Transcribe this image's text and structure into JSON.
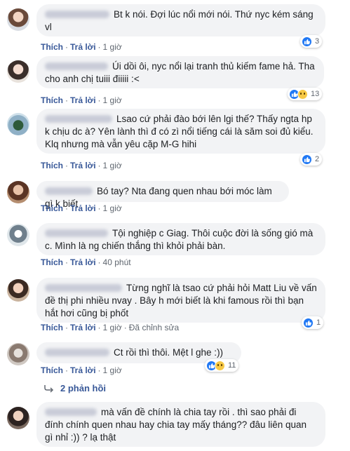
{
  "actions": {
    "like": "Thích",
    "reply": "Trả lời",
    "separator": "·"
  },
  "comments": [
    {
      "text": "Bt k nói. Đợi lúc nổi mới nói. Thứ nyc kém sáng vl",
      "time": "1 giờ",
      "edited": "",
      "reaction_count": "3"
    },
    {
      "text": "Úi dồi ôi, nyc nổi lại tranh thủ kiếm fame hả. Tha cho anh chị tuiii điiiii :<",
      "time": "1 giờ",
      "edited": "",
      "reaction_count": "13"
    },
    {
      "text": "Lsao cứ phải đào bới lên lgi thế? Thấy ngta hp k chịu dc à? Yên lành thì đ có zì nổi tiếng cái là săm soi đủ kiểu. Klq nhưng mà vẫn yêu cặp M-G hihi",
      "time": "1 giờ",
      "edited": "",
      "reaction_count": "2"
    },
    {
      "text": "Bó tay? Nta đang quen nhau bới móc làm gì k biết",
      "time": "1 giờ",
      "edited": "",
      "reaction_count": ""
    },
    {
      "text": "Tội nghiệp c Giag. Thôi cuộc đời là sống gió mà c. Mình là ng chiến thắng thì khỏi phải bàn.",
      "time": "40 phút",
      "edited": "",
      "reaction_count": ""
    },
    {
      "text": "Từng nghĩ là tsao cứ phải hỏi Matt Liu về vấn đề thị phi nhiều nvay . Bây h mới biết là khi famous rồi thì bạn hắt hơi cũng bị phốt",
      "time": "1 giờ",
      "edited": "Đã chỉnh sửa",
      "reaction_count": "1"
    },
    {
      "text": "Ct rồi thì thôi. Mệt l ghe :))",
      "time": "1 giờ",
      "edited": "",
      "reaction_count": "11"
    },
    {
      "text": "mà vấn đề chính là chia tay rồi . thì sao phải đi đính chính quen nhau hay chia tay mấy tháng?? đâu liên quan gì nhỉ :)) ? lạ thật",
      "time": "",
      "edited": "",
      "reaction_count": ""
    }
  ],
  "replies_link": "2 phản hồi",
  "colors": {
    "link": "#385898",
    "bubble": "#f2f3f5",
    "like": "#2078f4",
    "meta": "#606770"
  }
}
